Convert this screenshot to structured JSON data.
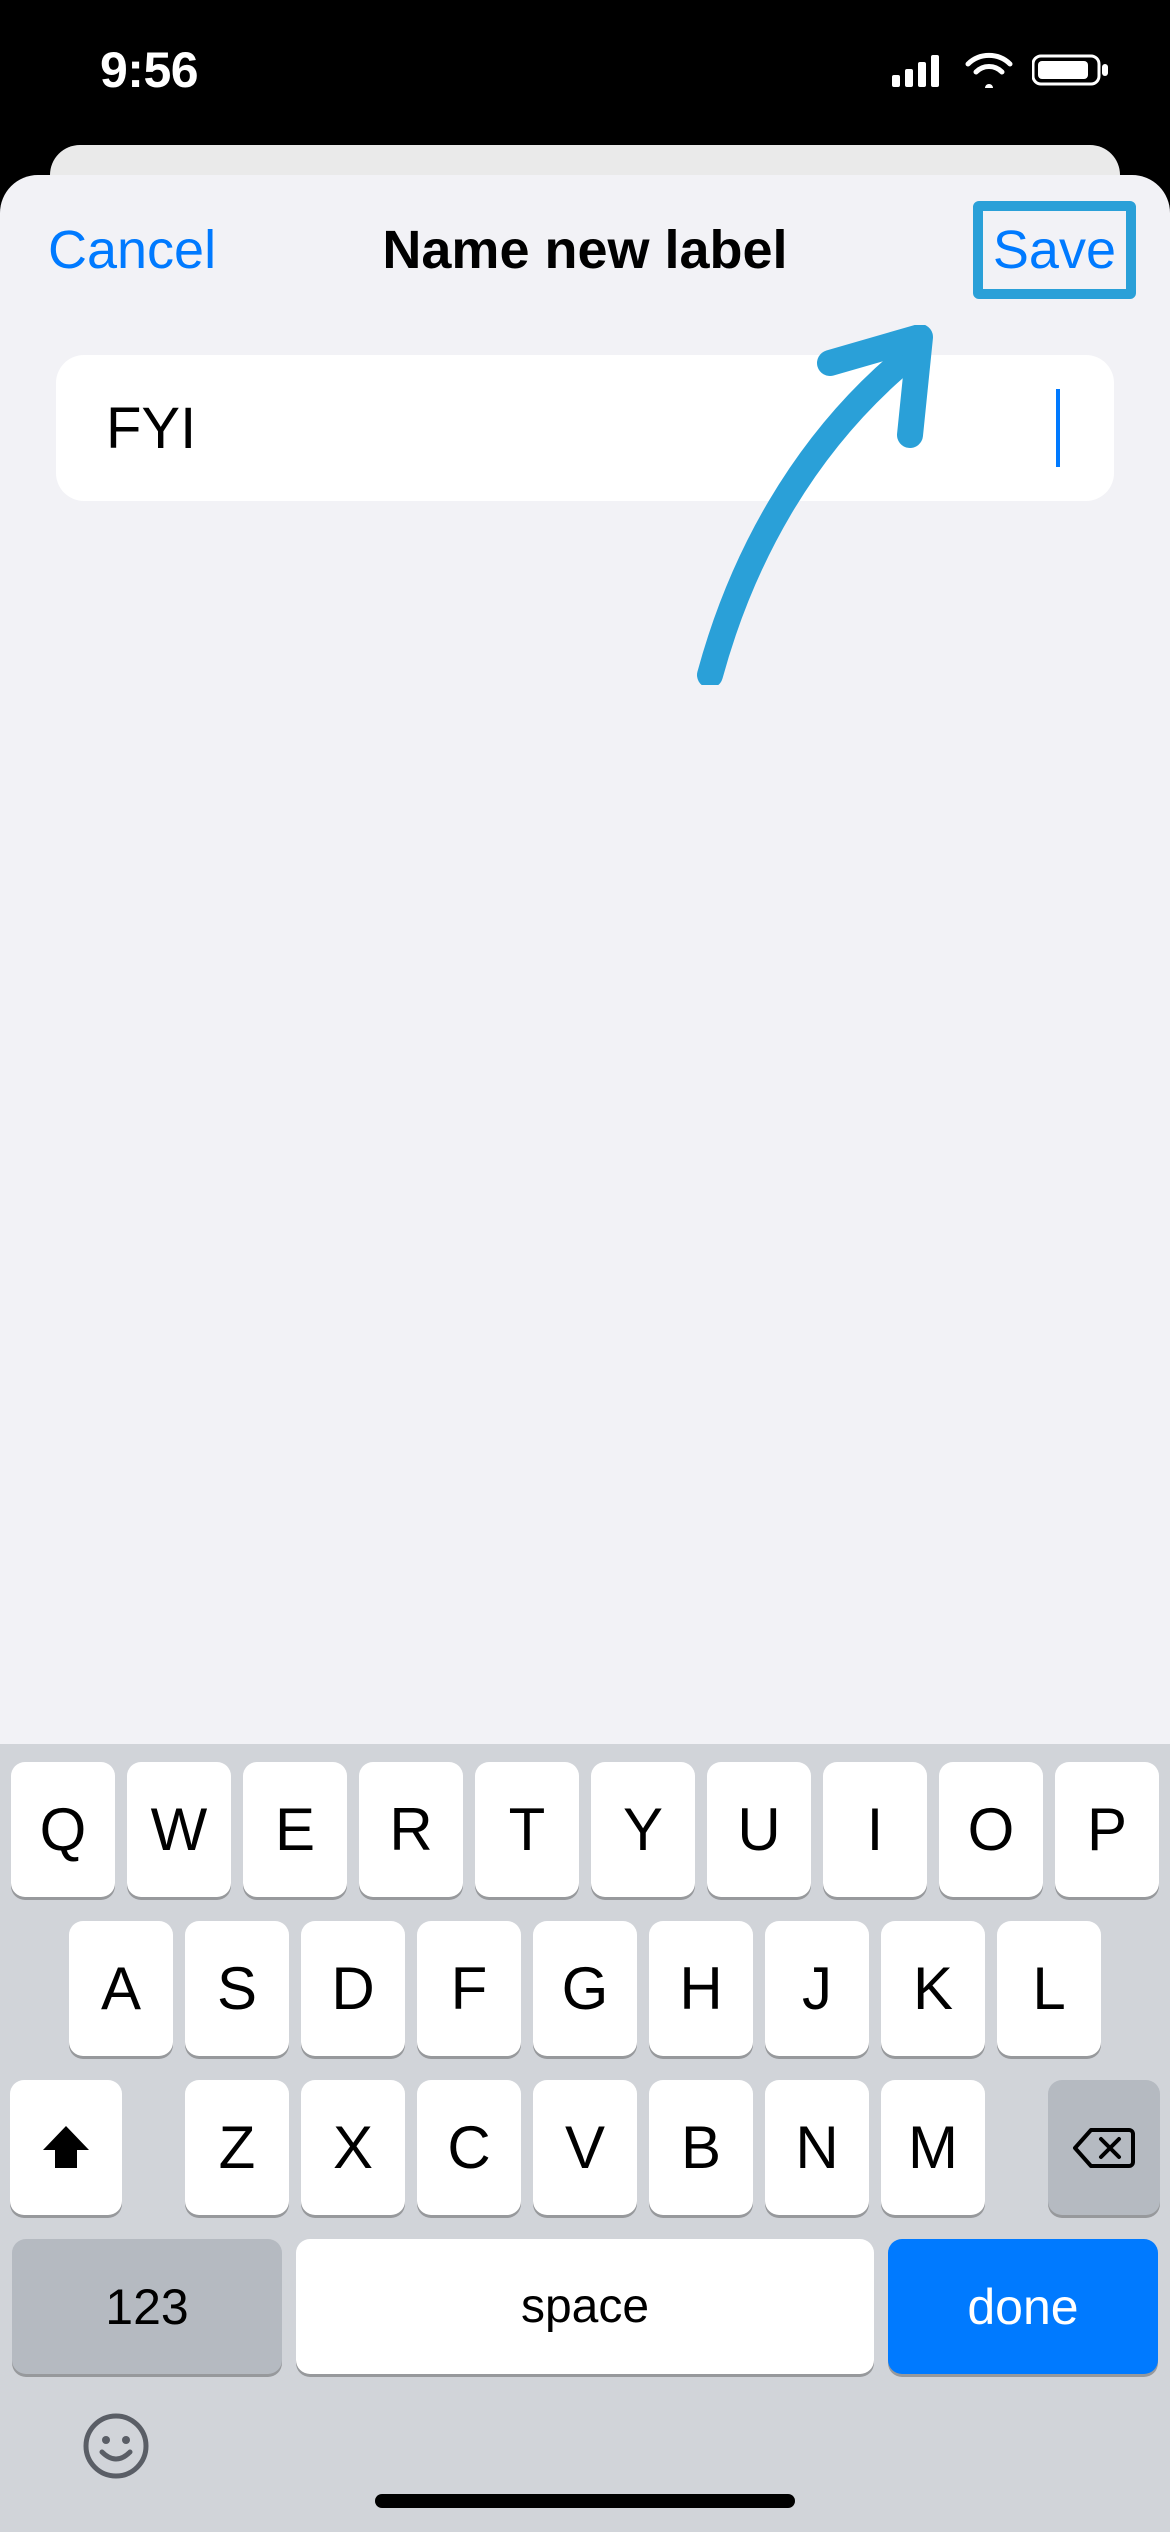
{
  "status": {
    "time": "9:56"
  },
  "modal": {
    "title": "Name new label",
    "cancel_label": "Cancel",
    "save_label": "Save",
    "input_value": "FYI"
  },
  "keyboard": {
    "row1": [
      "Q",
      "W",
      "E",
      "R",
      "T",
      "Y",
      "U",
      "I",
      "O",
      "P"
    ],
    "row2": [
      "A",
      "S",
      "D",
      "F",
      "G",
      "H",
      "J",
      "K",
      "L"
    ],
    "row3": [
      "Z",
      "X",
      "C",
      "V",
      "B",
      "N",
      "M"
    ],
    "num_label": "123",
    "space_label": "space",
    "done_label": "done"
  }
}
